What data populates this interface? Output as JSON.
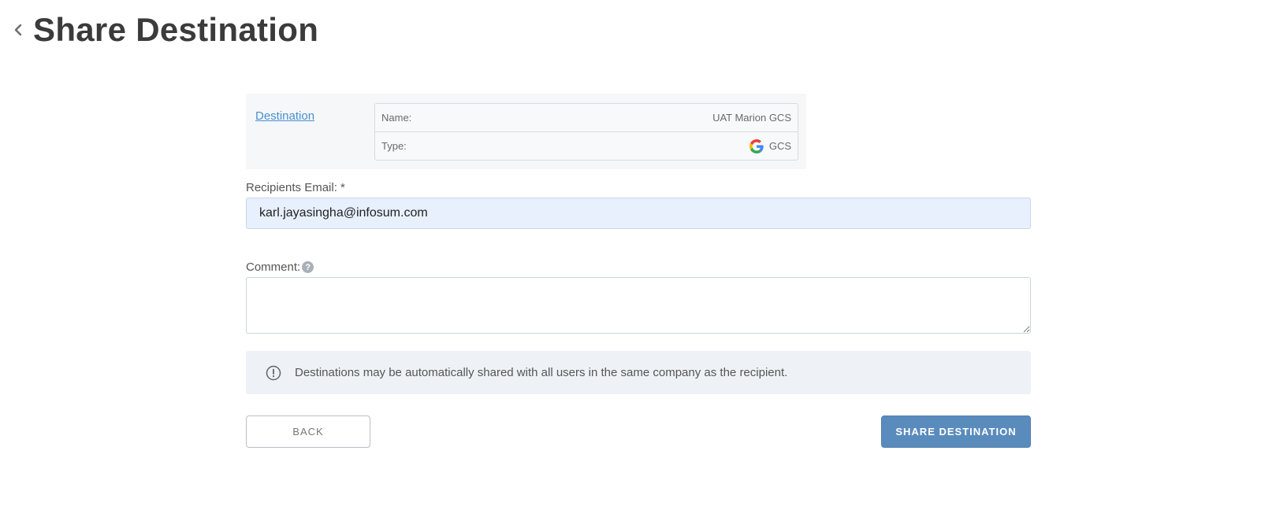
{
  "header": {
    "back_icon": "chevron-left-icon",
    "title": "Share Destination"
  },
  "destination": {
    "link_label": "Destination",
    "rows": [
      {
        "label": "Name:",
        "value": "UAT Marion GCS"
      },
      {
        "label": "Type:",
        "value": "GCS",
        "icon": "google-icon"
      }
    ]
  },
  "form": {
    "email_label": "Recipients Email: *",
    "email_value": "karl.jayasingha@infosum.com",
    "comment_label": "Comment:",
    "comment_help_icon": "question-circle-icon",
    "comment_value": ""
  },
  "notice": {
    "icon": "info-circle-icon",
    "text": "Destinations may be automatically shared with all users in the same company as the recipient."
  },
  "buttons": {
    "back_label": "BACK",
    "share_label": "SHARE DESTINATION"
  },
  "colors": {
    "primary_button": "#5a8bbd",
    "link": "#4a8fd0",
    "email_input_bg": "#e8f0fd",
    "notice_bg": "#eef2f6",
    "card_bg": "#f5f7f9"
  }
}
